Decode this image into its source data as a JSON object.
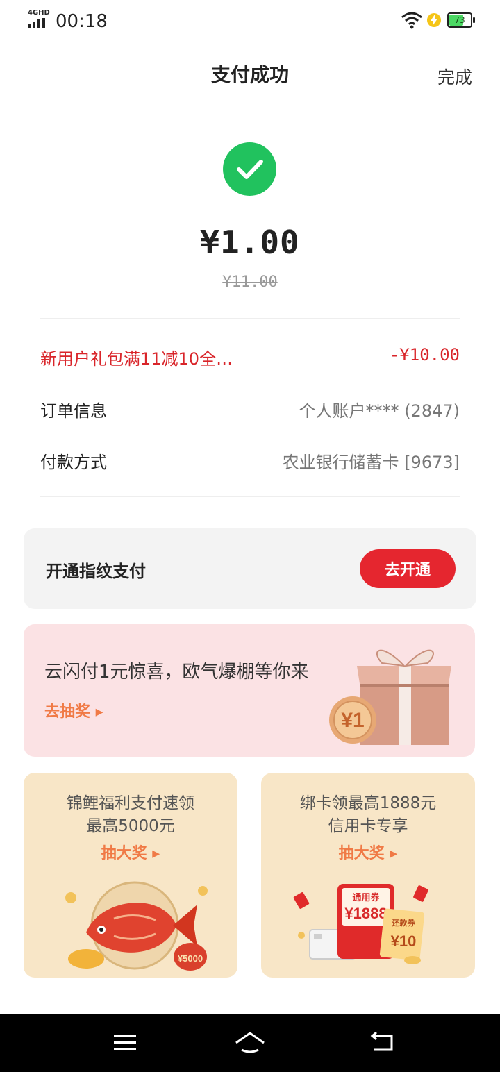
{
  "status_bar": {
    "network": "4GHD",
    "time": "00:18",
    "battery": "73",
    "battery_level": 0.73
  },
  "header": {
    "title": "支付成功",
    "done_label": "完成"
  },
  "payment": {
    "amount": "¥1.00",
    "original_amount": "¥11.00"
  },
  "details": {
    "promo_label": "新用户礼包满11减10全…",
    "promo_value": "-¥10.00",
    "order_label": "订单信息",
    "order_value": "个人账户**** (2847)",
    "method_label": "付款方式",
    "method_value": "农业银行储蓄卡 [9673]"
  },
  "fingerprint": {
    "text": "开通指纹支付",
    "button": "去开通"
  },
  "lucky": {
    "title": "云闪付1元惊喜，欧气爆棚等你来",
    "link": "去抽奖 ▸",
    "coin": "¥1"
  },
  "card_left": {
    "line1": "锦鲤福利支付速领",
    "line2": "最高5000元",
    "link": "抽大奖 ▸",
    "bag_label": "¥5000"
  },
  "card_right": {
    "line1": "绑卡领最高1888元",
    "line2": "信用卡专享",
    "link": "抽大奖 ▸",
    "coupon_title": "通用券",
    "coupon_value": "¥1888",
    "ticket_title": "还款券",
    "ticket_value": "¥10"
  },
  "colors": {
    "accent_red": "#e5262f",
    "success_green": "#21c25e",
    "link_orange": "#f07a46"
  },
  "icons": {
    "check": "check-icon",
    "wifi": "wifi-icon",
    "charging": "charging-icon",
    "menu": "menu-icon",
    "home": "home-icon",
    "back": "back-icon"
  }
}
